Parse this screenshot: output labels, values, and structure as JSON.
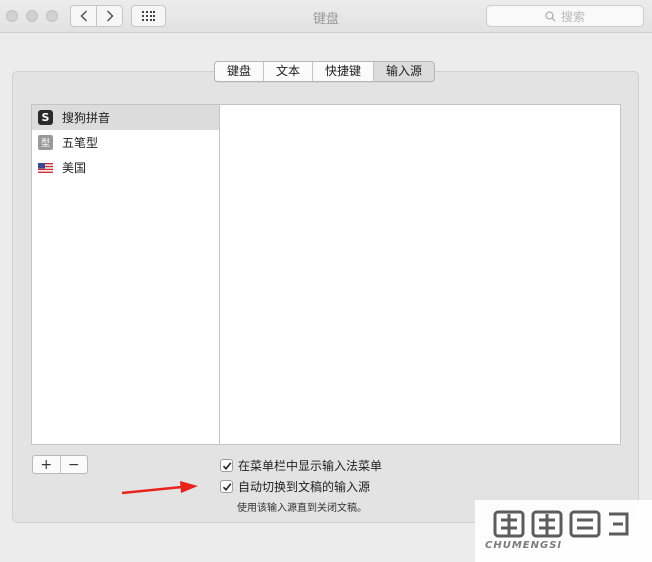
{
  "window": {
    "title": "键盘"
  },
  "search": {
    "placeholder": "搜索"
  },
  "tabs": [
    {
      "label": "键盘",
      "selected": false
    },
    {
      "label": "文本",
      "selected": false
    },
    {
      "label": "快捷键",
      "selected": false
    },
    {
      "label": "输入源",
      "selected": true
    }
  ],
  "input_sources": [
    {
      "label": "搜狗拼音",
      "icon": "sogou-icon",
      "selected": true
    },
    {
      "label": "五笔型",
      "icon": "wubi-icon",
      "icon_glyph": "型",
      "selected": false
    },
    {
      "label": "美国",
      "icon": "us-flag-icon",
      "selected": false
    }
  ],
  "buttons": {
    "add": "+",
    "remove": "−"
  },
  "options": {
    "show_menu": {
      "label": "在菜单栏中显示输入法菜单",
      "checked": true
    },
    "auto_switch": {
      "label": "自动切换到文稿的输入源",
      "checked": true
    },
    "auto_switch_hint": "使用该输入源直到关闭文稿。"
  },
  "watermark": {
    "text": "CHUMENGSI"
  },
  "colors": {
    "arrow": "#e8231c"
  }
}
